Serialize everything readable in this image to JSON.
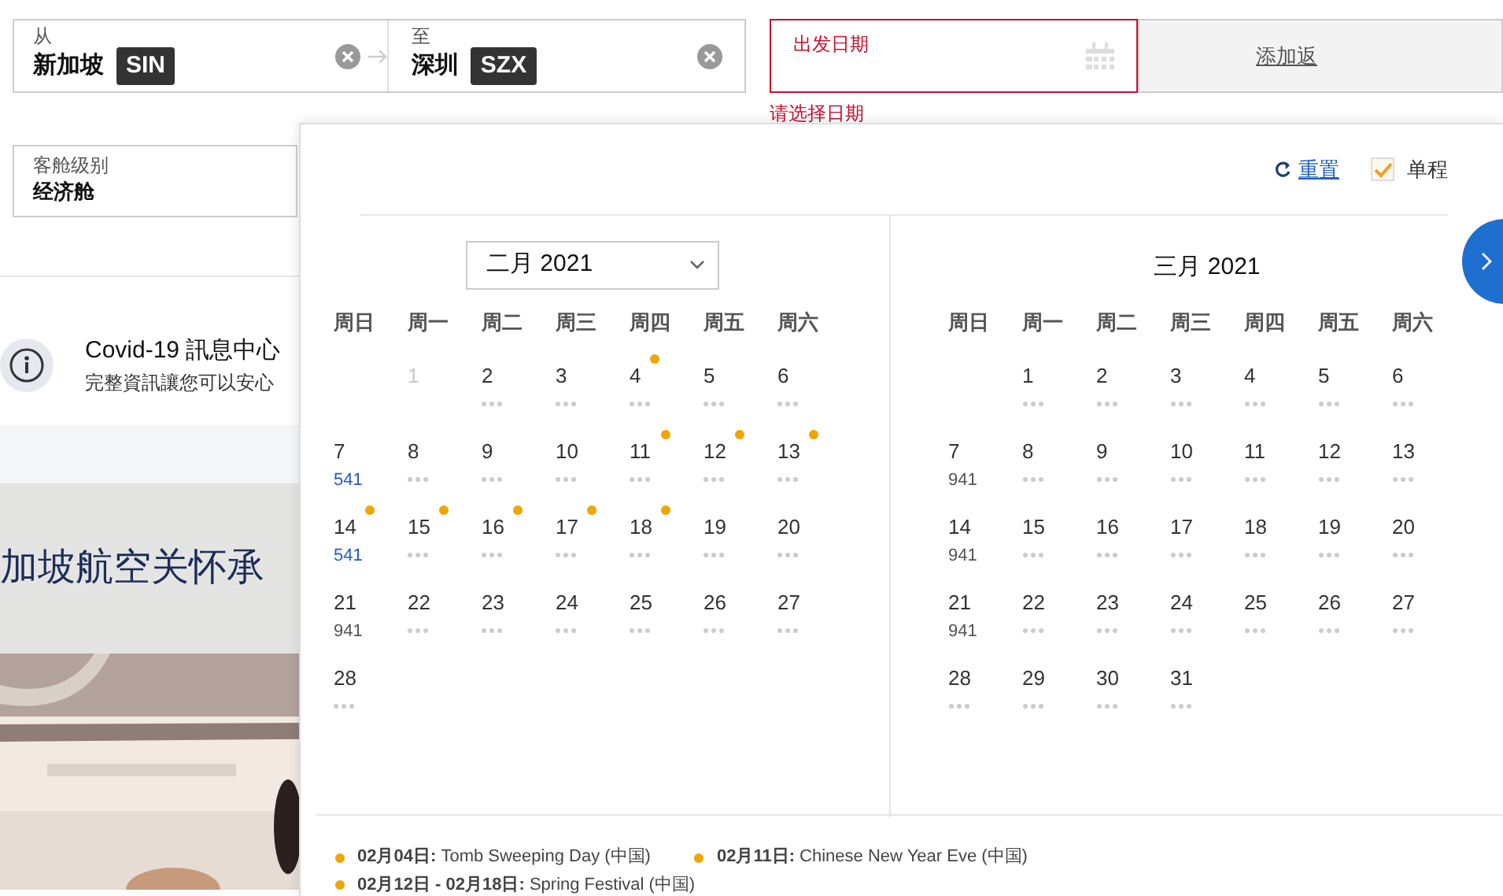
{
  "trip": {
    "from": {
      "label": "从",
      "city": "新加坡",
      "code": "SIN"
    },
    "to": {
      "label": "至",
      "city": "深圳",
      "code": "SZX"
    }
  },
  "departure": {
    "label": "出发日期",
    "error": "请选择日期"
  },
  "return": {
    "label": "添加返"
  },
  "cabin": {
    "label": "客舱级别",
    "value": "经济舱"
  },
  "covid": {
    "title": "Covid-19 訊息中心",
    "subtitle": "完整資訊讓您可以安心"
  },
  "promo": {
    "headline": "加坡航空关怀承"
  },
  "picker": {
    "reset": "重置",
    "one_way": {
      "label": "单程",
      "checked": true
    },
    "months": [
      {
        "title": "二月 2021",
        "kind": "select",
        "weekdays": [
          "周日",
          "周一",
          "周二",
          "周三",
          "周四",
          "周五",
          "周六"
        ],
        "weeks": [
          [
            {
              "kind": "blank"
            },
            {
              "kind": "day",
              "day": "1",
              "disabled": true,
              "holiday": false
            },
            {
              "kind": "day",
              "day": "2",
              "disabled": false,
              "holiday": false
            },
            {
              "kind": "day",
              "day": "3",
              "disabled": false,
              "holiday": false
            },
            {
              "kind": "day",
              "day": "4",
              "disabled": false,
              "holiday": true
            },
            {
              "kind": "day",
              "day": "5",
              "disabled": false,
              "holiday": false
            },
            {
              "kind": "day",
              "day": "6",
              "disabled": false,
              "holiday": false
            }
          ],
          [
            {
              "kind": "day",
              "day": "7",
              "disabled": false,
              "holiday": false,
              "fare": {
                "text": "541",
                "lowest": true
              }
            },
            {
              "kind": "day",
              "day": "8",
              "disabled": false,
              "holiday": false
            },
            {
              "kind": "day",
              "day": "9",
              "disabled": false,
              "holiday": false
            },
            {
              "kind": "day",
              "day": "10",
              "disabled": false,
              "holiday": false
            },
            {
              "kind": "day",
              "day": "11",
              "disabled": false,
              "holiday": true
            },
            {
              "kind": "day",
              "day": "12",
              "disabled": false,
              "holiday": true
            },
            {
              "kind": "day",
              "day": "13",
              "disabled": false,
              "holiday": true
            }
          ],
          [
            {
              "kind": "day",
              "day": "14",
              "disabled": false,
              "holiday": true,
              "fare": {
                "text": "541",
                "lowest": true
              }
            },
            {
              "kind": "day",
              "day": "15",
              "disabled": false,
              "holiday": true
            },
            {
              "kind": "day",
              "day": "16",
              "disabled": false,
              "holiday": true
            },
            {
              "kind": "day",
              "day": "17",
              "disabled": false,
              "holiday": true
            },
            {
              "kind": "day",
              "day": "18",
              "disabled": false,
              "holiday": true
            },
            {
              "kind": "day",
              "day": "19",
              "disabled": false,
              "holiday": false
            },
            {
              "kind": "day",
              "day": "20",
              "disabled": false,
              "holiday": false
            }
          ],
          [
            {
              "kind": "day",
              "day": "21",
              "disabled": false,
              "holiday": false,
              "fare": {
                "text": "941",
                "lowest": false
              }
            },
            {
              "kind": "day",
              "day": "22",
              "disabled": false,
              "holiday": false
            },
            {
              "kind": "day",
              "day": "23",
              "disabled": false,
              "holiday": false
            },
            {
              "kind": "day",
              "day": "24",
              "disabled": false,
              "holiday": false
            },
            {
              "kind": "day",
              "day": "25",
              "disabled": false,
              "holiday": false
            },
            {
              "kind": "day",
              "day": "26",
              "disabled": false,
              "holiday": false
            },
            {
              "kind": "day",
              "day": "27",
              "disabled": false,
              "holiday": false
            }
          ],
          [
            {
              "kind": "day",
              "day": "28",
              "disabled": false,
              "holiday": false
            }
          ]
        ]
      },
      {
        "title": "三月 2021",
        "kind": "heading",
        "weekdays": [
          "周日",
          "周一",
          "周二",
          "周三",
          "周四",
          "周五",
          "周六"
        ],
        "weeks": [
          [
            {
              "kind": "blank"
            },
            {
              "kind": "day",
              "day": "1",
              "disabled": false,
              "holiday": false
            },
            {
              "kind": "day",
              "day": "2",
              "disabled": false,
              "holiday": false
            },
            {
              "kind": "day",
              "day": "3",
              "disabled": false,
              "holiday": false
            },
            {
              "kind": "day",
              "day": "4",
              "disabled": false,
              "holiday": false
            },
            {
              "kind": "day",
              "day": "5",
              "disabled": false,
              "holiday": false
            },
            {
              "kind": "day",
              "day": "6",
              "disabled": false,
              "holiday": false
            }
          ],
          [
            {
              "kind": "day",
              "day": "7",
              "disabled": false,
              "holiday": false,
              "fare": {
                "text": "941",
                "lowest": false
              }
            },
            {
              "kind": "day",
              "day": "8",
              "disabled": false,
              "holiday": false
            },
            {
              "kind": "day",
              "day": "9",
              "disabled": false,
              "holiday": false
            },
            {
              "kind": "day",
              "day": "10",
              "disabled": false,
              "holiday": false
            },
            {
              "kind": "day",
              "day": "11",
              "disabled": false,
              "holiday": false
            },
            {
              "kind": "day",
              "day": "12",
              "disabled": false,
              "holiday": false
            },
            {
              "kind": "day",
              "day": "13",
              "disabled": false,
              "holiday": false
            }
          ],
          [
            {
              "kind": "day",
              "day": "14",
              "disabled": false,
              "holiday": false,
              "fare": {
                "text": "941",
                "lowest": false
              }
            },
            {
              "kind": "day",
              "day": "15",
              "disabled": false,
              "holiday": false
            },
            {
              "kind": "day",
              "day": "16",
              "disabled": false,
              "holiday": false
            },
            {
              "kind": "day",
              "day": "17",
              "disabled": false,
              "holiday": false
            },
            {
              "kind": "day",
              "day": "18",
              "disabled": false,
              "holiday": false
            },
            {
              "kind": "day",
              "day": "19",
              "disabled": false,
              "holiday": false
            },
            {
              "kind": "day",
              "day": "20",
              "disabled": false,
              "holiday": false
            }
          ],
          [
            {
              "kind": "day",
              "day": "21",
              "disabled": false,
              "holiday": false,
              "fare": {
                "text": "941",
                "lowest": false
              }
            },
            {
              "kind": "day",
              "day": "22",
              "disabled": false,
              "holiday": false
            },
            {
              "kind": "day",
              "day": "23",
              "disabled": false,
              "holiday": false
            },
            {
              "kind": "day",
              "day": "24",
              "disabled": false,
              "holiday": false
            },
            {
              "kind": "day",
              "day": "25",
              "disabled": false,
              "holiday": false
            },
            {
              "kind": "day",
              "day": "26",
              "disabled": false,
              "holiday": false
            },
            {
              "kind": "day",
              "day": "27",
              "disabled": false,
              "holiday": false
            }
          ],
          [
            {
              "kind": "day",
              "day": "28",
              "disabled": false,
              "holiday": false
            },
            {
              "kind": "day",
              "day": "29",
              "disabled": false,
              "holiday": false
            },
            {
              "kind": "day",
              "day": "30",
              "disabled": false,
              "holiday": false
            },
            {
              "kind": "day",
              "day": "31",
              "disabled": false,
              "holiday": false
            }
          ]
        ]
      }
    ],
    "holidays": [
      {
        "text": "**02月04日:** Tomb Sweeping Day (中国)"
      },
      {
        "text": "**02月11日:** Chinese New Year Eve (中国)"
      },
      {
        "text": "**02月12日 - 02月18日:** Spring Festival (中国)"
      }
    ]
  }
}
